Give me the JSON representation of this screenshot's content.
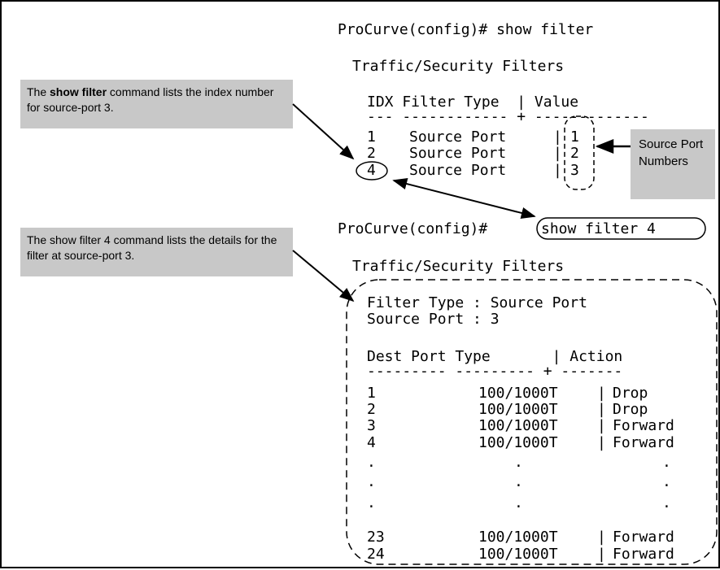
{
  "terminal": {
    "cmd1": "ProCurve(config)# show filter",
    "title1": "Traffic/Security Filters",
    "table1": {
      "header": "IDX Filter Type  | Value",
      "rule": "--- ------------ + -------------",
      "rows": [
        {
          "idx": "1",
          "type": "Source Port",
          "sep": "|",
          "value": "1"
        },
        {
          "idx": "2",
          "type": "Source Port",
          "sep": "|",
          "value": "2"
        },
        {
          "idx": "4",
          "type": "Source Port",
          "sep": "|",
          "value": "3"
        }
      ]
    },
    "cmd2_prompt": "ProCurve(config)#",
    "cmd2_command": "show filter 4",
    "title2": "Traffic/Security Filters",
    "filter_type_line": "Filter Type : Source Port",
    "source_port_line": "Source Port : 3",
    "table2": {
      "header": "Dest Port Type       | Action",
      "rule": "--------- --------- + -------",
      "rows": [
        {
          "port": "1",
          "type": "100/1000T",
          "sep": "|",
          "action": "Drop"
        },
        {
          "port": "2",
          "type": "100/1000T",
          "sep": "|",
          "action": "Drop"
        },
        {
          "port": "3",
          "type": "100/1000T",
          "sep": "|",
          "action": "Forward"
        },
        {
          "port": "4",
          "type": "100/1000T",
          "sep": "|",
          "action": "Forward"
        },
        {
          "port": ".",
          "type": ".",
          "sep": "",
          "action": "."
        },
        {
          "port": ".",
          "type": ".",
          "sep": "",
          "action": "."
        },
        {
          "port": ".",
          "type": ".",
          "sep": "",
          "action": "."
        },
        {
          "port": "23",
          "type": "100/1000T",
          "sep": "|",
          "action": "Forward"
        },
        {
          "port": "24",
          "type": "100/1000T",
          "sep": "|",
          "action": "Forward"
        }
      ]
    }
  },
  "callouts": {
    "show_filter": {
      "pre": "The ",
      "bold": "show filter",
      "post": " command lists the index number for source-port 3."
    },
    "show_filter_4": "The show filter 4 command lists the details for the filter at source-port 3.",
    "source_port_numbers": "Source Port Numbers"
  },
  "colors": {
    "callout_bg": "#c8c8c8",
    "text": "#000000",
    "border": "#000000"
  }
}
